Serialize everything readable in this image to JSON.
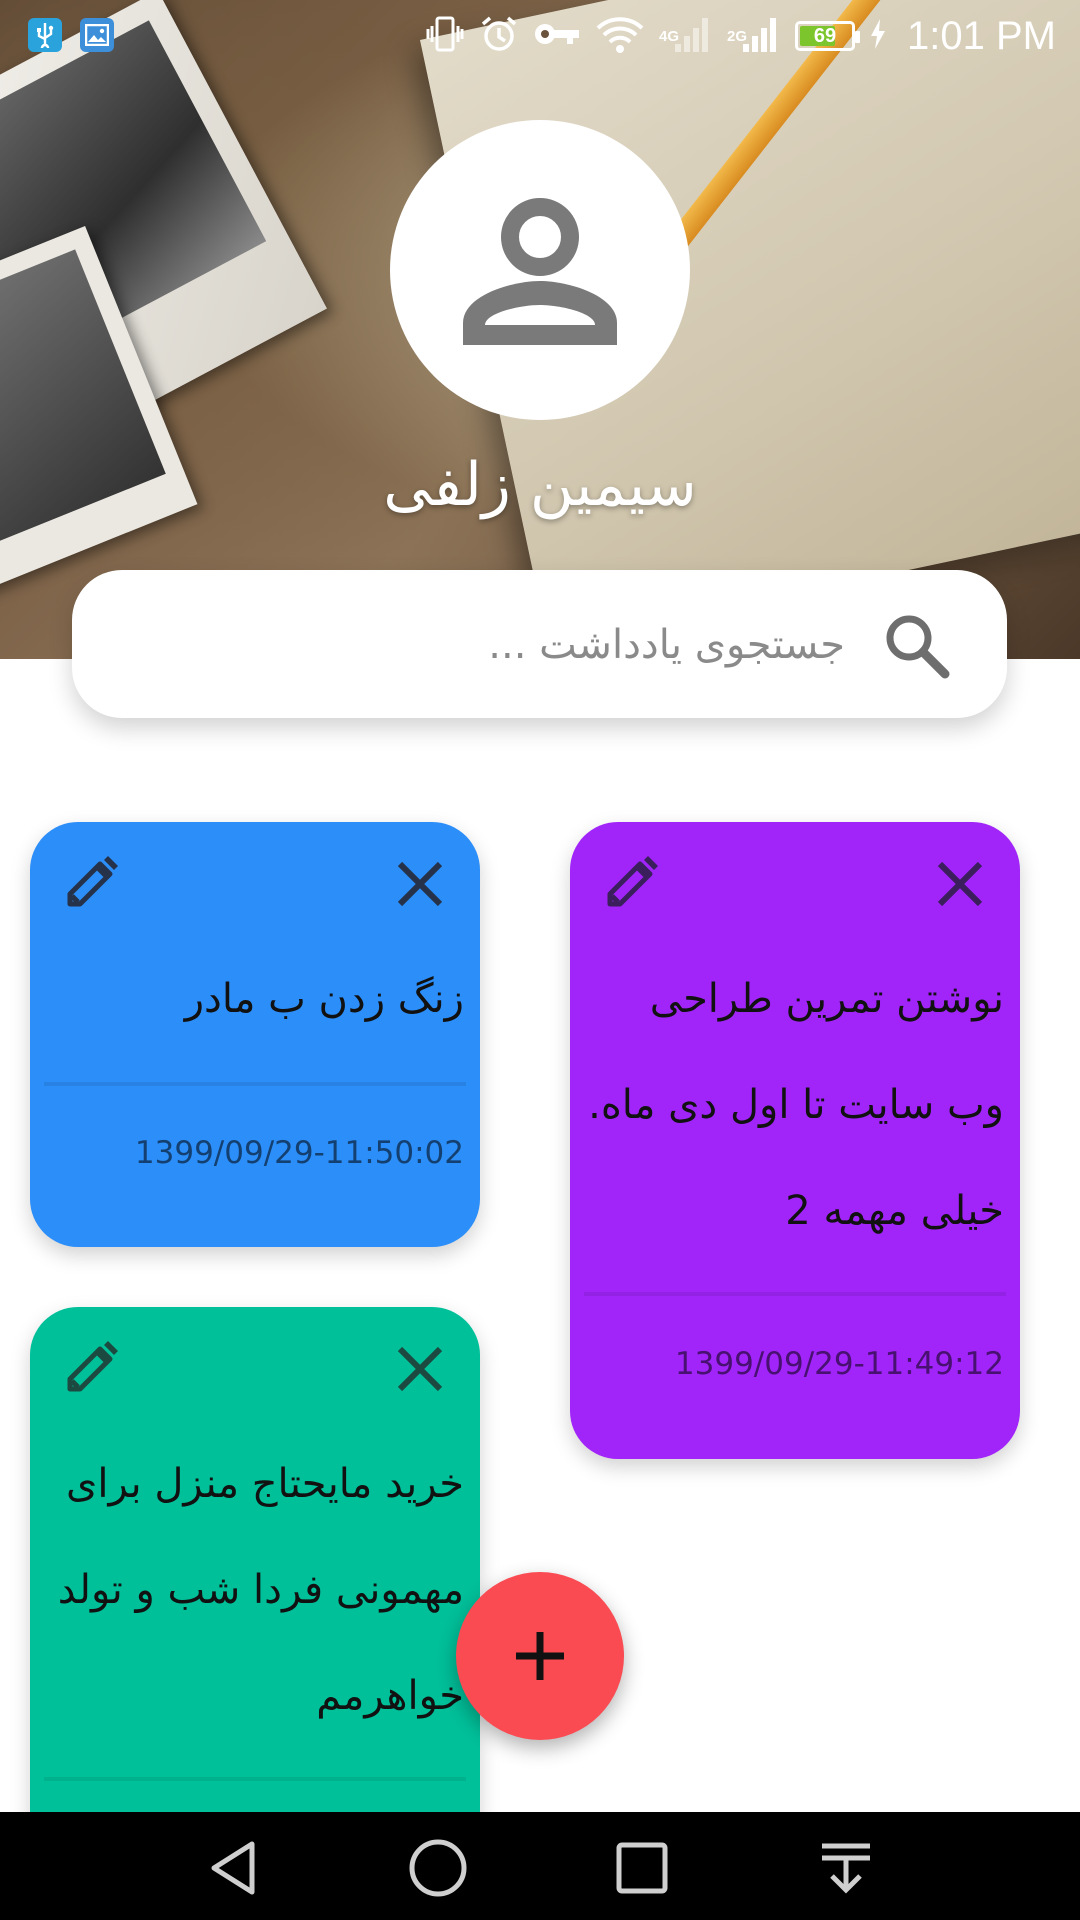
{
  "status_bar": {
    "time": "1:01 PM",
    "battery_level": "69",
    "battery_fill": 0.69,
    "battery_color": "#7cc52c",
    "network_1": "4G",
    "network_2": "2G",
    "icons": [
      "usb-icon",
      "gallery-icon",
      "vibrate-icon",
      "alarm-icon",
      "vpn-key-icon",
      "wifi-icon",
      "signal-icon",
      "signal-icon",
      "battery-icon",
      "charging-icon"
    ]
  },
  "profile": {
    "name": "سیمین زلفی",
    "avatar_icon": "person-icon"
  },
  "search": {
    "placeholder": "جستجوی یادداشت ...",
    "value": ""
  },
  "notes": [
    {
      "text": "زنگ زدن ب مادر",
      "date": "1399/09/29-11:50:02",
      "color": "#2c8ef8"
    },
    {
      "text": "نوشتن تمرین طراحی وب سایت تا اول دی ماه. خیلی مهمه 2",
      "date": "1399/09/29-11:49:12",
      "color": "#a125f9"
    },
    {
      "text": "خرید مایحتاج منزل برای مهمونی فردا شب و تولد خواهرمم",
      "date": "",
      "color": "#00c09a"
    }
  ],
  "fab": {
    "label": "+",
    "color": "#fa4a52"
  },
  "nav": {
    "buttons": [
      "back-icon",
      "home-icon",
      "recents-icon",
      "notification-pull-icon"
    ]
  }
}
